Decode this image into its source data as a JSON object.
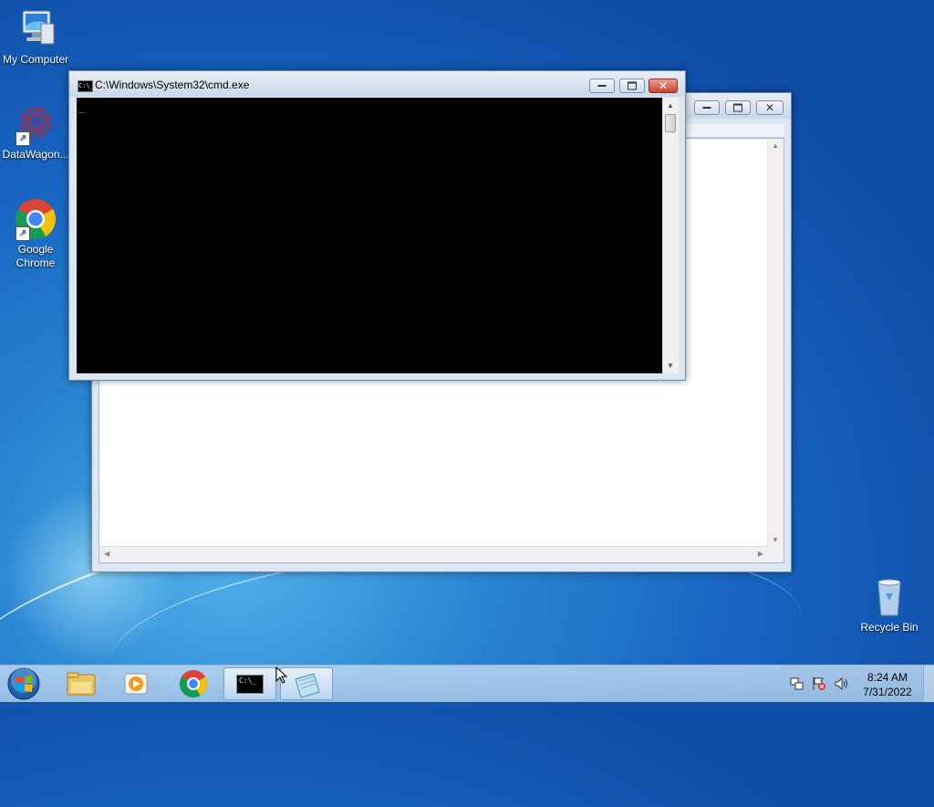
{
  "desktop": {
    "icons": [
      {
        "label": "My Computer"
      },
      {
        "label": "DataWagon..."
      },
      {
        "label": "Google Chrome"
      },
      {
        "label": "Recycle Bin"
      }
    ]
  },
  "cmd_window": {
    "title": "C:\\Windows\\System32\\cmd.exe",
    "icon_text": "C:\\_",
    "cursor": "_"
  },
  "back_window": {
    "title": ""
  },
  "taskbar": {
    "cmd_icon_text": "C:\\_",
    "clock_time": "8:24 AM",
    "clock_date": "7/31/2022"
  },
  "colors": {
    "console_bg": "#000000",
    "desktop_blue": "#1866c2"
  }
}
